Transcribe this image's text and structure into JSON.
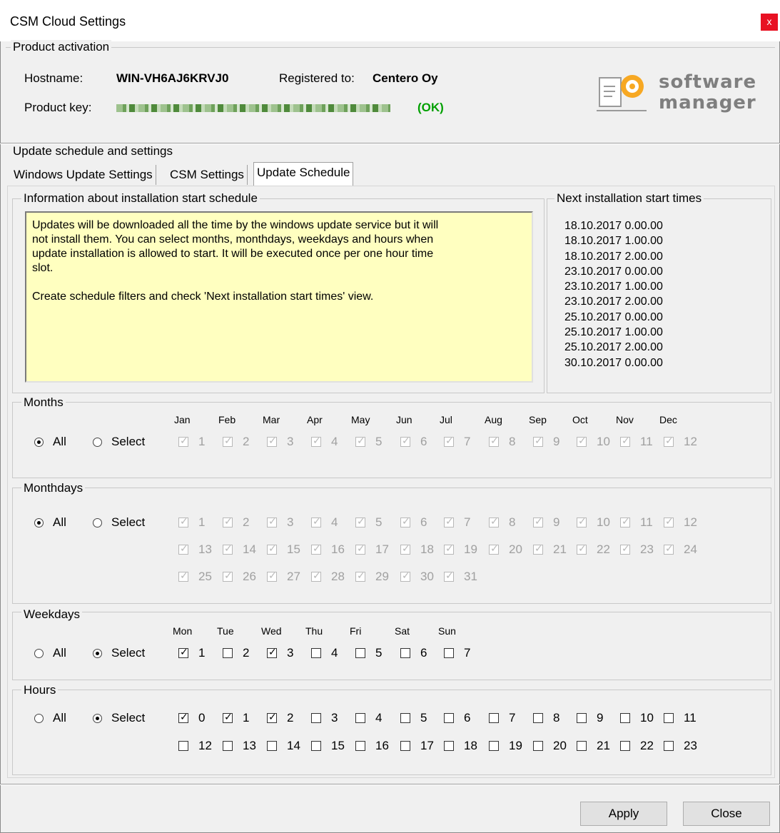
{
  "window": {
    "title": "CSM Cloud Settings",
    "close_glyph": "x"
  },
  "activation": {
    "group_title": "Product activation",
    "hostname_label": "Hostname:",
    "hostname_value": "WIN-VH6AJ6KRVJ0",
    "registered_label": "Registered to:",
    "registered_value": "Centero Oy",
    "productkey_label": "Product key:",
    "productkey_status": "(OK)",
    "logo_line1": "software",
    "logo_line2": "manager"
  },
  "update": {
    "group_title": "Update schedule and settings",
    "tabs": [
      "Windows Update Settings",
      "CSM Settings",
      "Update Schedule"
    ],
    "active_tab": "Update Schedule",
    "info_title": "Information about installation start schedule",
    "info_text": "Updates will be downloaded all the time by the windows update service but it will\nnot install them. You can select months, monthdays, weekdays and hours when\nupdate installation is allowed to start. It will be executed once per one hour time\nslot.\n\nCreate schedule filters and check 'Next installation start times' view.",
    "next_title": "Next installation start times",
    "next_times": [
      "18.10.2017 0.00.00",
      "18.10.2017 1.00.00",
      "18.10.2017 2.00.00",
      "23.10.2017 0.00.00",
      "23.10.2017 1.00.00",
      "23.10.2017 2.00.00",
      "25.10.2017 0.00.00",
      "25.10.2017 1.00.00",
      "25.10.2017 2.00.00",
      "30.10.2017 0.00.00"
    ]
  },
  "radio_labels": {
    "all": "All",
    "select": "Select"
  },
  "months": {
    "title": "Months",
    "mode": "All",
    "columns": [
      "Jan",
      "Feb",
      "Mar",
      "Apr",
      "May",
      "Jun",
      "Jul",
      "Aug",
      "Sep",
      "Oct",
      "Nov",
      "Dec"
    ],
    "items": [
      "1",
      "2",
      "3",
      "4",
      "5",
      "6",
      "7",
      "8",
      "9",
      "10",
      "11",
      "12"
    ],
    "checked": [
      true,
      true,
      true,
      true,
      true,
      true,
      true,
      true,
      true,
      true,
      true,
      true
    ]
  },
  "monthdays": {
    "title": "Monthdays",
    "mode": "All",
    "items": [
      "1",
      "2",
      "3",
      "4",
      "5",
      "6",
      "7",
      "8",
      "9",
      "10",
      "11",
      "12",
      "13",
      "14",
      "15",
      "16",
      "17",
      "18",
      "19",
      "20",
      "21",
      "22",
      "23",
      "24",
      "25",
      "26",
      "27",
      "28",
      "29",
      "30",
      "31"
    ]
  },
  "weekdays": {
    "title": "Weekdays",
    "mode": "Select",
    "columns": [
      "Mon",
      "Tue",
      "Wed",
      "Thu",
      "Fri",
      "Sat",
      "Sun"
    ],
    "items": [
      "1",
      "2",
      "3",
      "4",
      "5",
      "6",
      "7"
    ],
    "checked": [
      true,
      false,
      true,
      false,
      false,
      false,
      false
    ]
  },
  "hours": {
    "title": "Hours",
    "mode": "Select",
    "items": [
      "0",
      "1",
      "2",
      "3",
      "4",
      "5",
      "6",
      "7",
      "8",
      "9",
      "10",
      "11",
      "12",
      "13",
      "14",
      "15",
      "16",
      "17",
      "18",
      "19",
      "20",
      "21",
      "22",
      "23"
    ],
    "checked": [
      true,
      true,
      true,
      false,
      false,
      false,
      false,
      false,
      false,
      false,
      false,
      false,
      false,
      false,
      false,
      false,
      false,
      false,
      false,
      false,
      false,
      false,
      false,
      false
    ]
  },
  "buttons": {
    "apply": "Apply",
    "close": "Close"
  }
}
